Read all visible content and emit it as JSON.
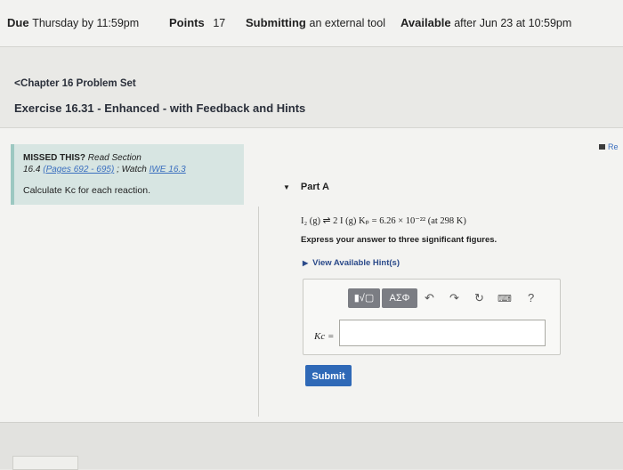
{
  "assignment": {
    "due_label": "Due",
    "due_value": "Thursday by 11:59pm",
    "points_label": "Points",
    "points_value": "17",
    "submitting_label": "Submitting",
    "submitting_value": "an external tool",
    "available_label": "Available",
    "available_value": "after Jun 23 at 10:59pm"
  },
  "breadcrumb": {
    "chevron": "<",
    "label": "Chapter 16 Problem Set"
  },
  "exercise_title": "Exercise 16.31 - Enhanced - with Feedback and Hints",
  "hint": {
    "missed_label": "MISSED THIS?",
    "read_label": "Read Section",
    "section": "16.4",
    "pages_link": "(Pages 692 - 695)",
    "watch_label": "; Watch",
    "watch_link": "IWE 16.3",
    "instruction": "Calculate Kc for each reaction."
  },
  "right_link": "Re",
  "part": {
    "label": "Part A",
    "equation": "I₂ (g) ⇌ 2 I (g)   Kₚ = 6.26 × 10⁻²² (at 298 K)",
    "instruction": "Express your answer to three significant figures.",
    "hints_link": "View Available Hint(s)",
    "toolbar": {
      "template_button": "▮√▢",
      "greek_button": "ΑΣΦ",
      "undo_icon": "undo-icon",
      "redo_icon": "redo-icon",
      "reset_icon": "reset-icon",
      "keyboard_icon": "keyboard-icon",
      "help_label": "?"
    },
    "answer_label": "Kc =",
    "answer_value": "",
    "submit_label": "Submit"
  }
}
